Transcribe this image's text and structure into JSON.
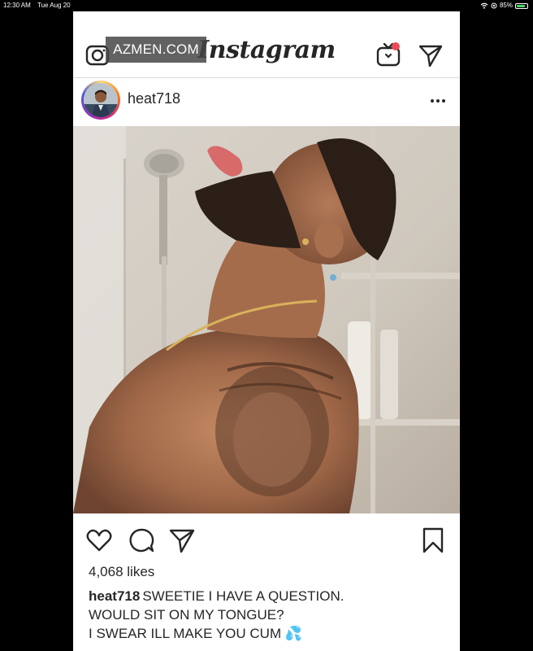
{
  "status_bar": {
    "time": "12:30 AM",
    "date": "Tue Aug 20",
    "battery": "85%",
    "battery_level": 0.85,
    "icons": [
      "wifi-icon",
      "location-icon",
      "battery-icon"
    ]
  },
  "watermark": "AZMEN.COM",
  "nav": {
    "logo": "Instagram",
    "icons": [
      "camera-icon",
      "igtv-icon",
      "direct-message-icon"
    ],
    "notification_color": "#ed4956"
  },
  "post": {
    "username": "heat718",
    "more_icon": "ellipsis-icon",
    "photo_icon": "shower-photo",
    "actions": [
      "heart-icon",
      "comment-icon",
      "share-icon",
      "bookmark-icon"
    ],
    "likes": "4,068 likes",
    "caption_user": "heat718",
    "caption_lines": [
      "SWEETIE I HAVE A QUESTION.",
      "WOULD SIT ON MY TONGUE?",
      "I SWEAR ILL MAKE YOU CUM 💦"
    ]
  },
  "colors": {
    "text": "#262626",
    "divider": "#dbdbdb",
    "frame": "#000000"
  }
}
